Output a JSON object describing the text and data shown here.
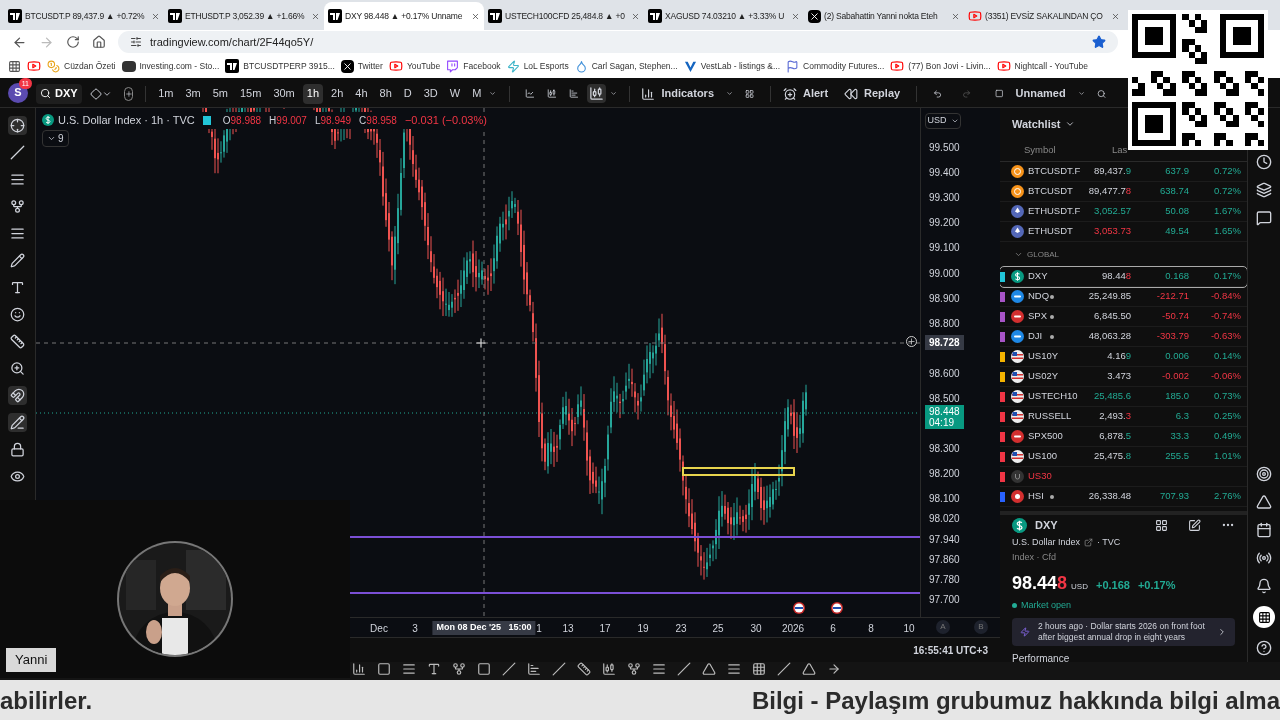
{
  "browser": {
    "tabs": [
      {
        "kind": "tv",
        "title": "BTCUSDT.P 89,437.9 ▲ +0.72%",
        "selected": false
      },
      {
        "kind": "tv",
        "title": "ETHUSDT.P 3,052.39 ▲ +1.66%",
        "selected": false
      },
      {
        "kind": "tv",
        "title": "DXY 98.448 ▲ +0.17% Unname",
        "selected": true
      },
      {
        "kind": "tv",
        "title": "USTECH100CFD 25,484.8 ▲ +0",
        "selected": false
      },
      {
        "kind": "tv",
        "title": "XAGUSD 74.03210 ▲ +3.33% U",
        "selected": false
      },
      {
        "kind": "x",
        "title": "(2) Sabahattin Yanni nokta Eteh",
        "selected": false
      },
      {
        "kind": "youtube",
        "title": "(3351) EVSİZ SAKALINDAN ÇO",
        "selected": false
      }
    ],
    "url": "tradingview.com/chart/2F44qo5Y/",
    "bookmarks": [
      {
        "kind": "youtube"
      },
      {
        "kind": "coin",
        "label": "Cüzdan Özeti"
      },
      {
        "kind": "inv",
        "label": "Investing.com - Sto..."
      },
      {
        "kind": "tv",
        "label": "BTCUSDTPERP 3915..."
      },
      {
        "kind": "x",
        "label": "Twitter"
      },
      {
        "kind": "youtube",
        "label": "YouTube"
      },
      {
        "kind": "twitch",
        "label": "Facebook"
      },
      {
        "kind": "lol",
        "label": "LoL Esports"
      },
      {
        "kind": "drop",
        "label": "Carl Sagan, Stephen..."
      },
      {
        "kind": "v",
        "label": "VestLab - listings &..."
      },
      {
        "kind": "flag",
        "label": "Commodity Futures..."
      },
      {
        "kind": "youtube",
        "label": "(77) Bon Jovi - Livin..."
      },
      {
        "kind": "youtube",
        "label": "Nightcall - YouTube"
      }
    ]
  },
  "toolbar": {
    "avatar": "S",
    "notifications": "11",
    "symbol": "DXY",
    "intervals": [
      {
        "label": "1m",
        "selected": false
      },
      {
        "label": "3m",
        "selected": false
      },
      {
        "label": "5m",
        "selected": false
      },
      {
        "label": "15m",
        "selected": false
      },
      {
        "label": "30m",
        "selected": false
      },
      {
        "label": "1h",
        "selected": true
      },
      {
        "label": "2h",
        "selected": false
      },
      {
        "label": "4h",
        "selected": false
      },
      {
        "label": "8h",
        "selected": false
      },
      {
        "label": "D",
        "selected": false
      },
      {
        "label": "3D",
        "selected": false
      },
      {
        "label": "W",
        "selected": false
      },
      {
        "label": "M",
        "selected": false
      }
    ],
    "indicators": "Indicators",
    "alert": "Alert",
    "replay": "Replay",
    "layout": "Unnamed"
  },
  "chart": {
    "title": "U.S. Dollar Index · 1h · TVC",
    "indicator_count": "9",
    "ohlc": [
      {
        "label": "O",
        "value": "98.988"
      },
      {
        "label": "H",
        "value": "99.007"
      },
      {
        "label": "L",
        "value": "98.949"
      },
      {
        "label": "C",
        "value": "98.958"
      }
    ],
    "change": "−0.031 (−0.03%)",
    "currency": "USD",
    "price_labels": [
      "99.500",
      "99.400",
      "99.300",
      "99.200",
      "99.100",
      "99.000",
      "98.900",
      "98.800",
      "98.600",
      "98.500",
      "98.300",
      "98.200",
      "98.100",
      "98.020",
      "97.940",
      "97.860",
      "97.780",
      "97.700"
    ],
    "crosshair_price": "98.728",
    "last_price": "98.448",
    "countdown": "04:19",
    "time_labels": [
      {
        "kind": "tick",
        "text": "Dec"
      },
      {
        "kind": "tick",
        "text": "3"
      },
      {
        "kind": "cursor",
        "text": "Mon 08 Dec '25   15:00"
      },
      {
        "kind": "tick",
        "text": "1"
      },
      {
        "kind": "tick",
        "text": "13"
      },
      {
        "kind": "tick",
        "text": "17"
      },
      {
        "kind": "tick",
        "text": "19"
      },
      {
        "kind": "tick",
        "text": "23"
      },
      {
        "kind": "tick",
        "text": "25"
      },
      {
        "kind": "tick",
        "text": "30"
      },
      {
        "kind": "tick",
        "text": "2026"
      },
      {
        "kind": "tick",
        "text": "6"
      },
      {
        "kind": "tick",
        "text": "8"
      },
      {
        "kind": "tick",
        "text": "10"
      },
      {
        "kind": "button",
        "text": "A"
      },
      {
        "kind": "button",
        "text": "B"
      }
    ],
    "clock": "16:55:41 UTC+3"
  },
  "watchlist": {
    "title": "Watchlist",
    "columns": [
      "Symbol",
      "Las"
    ],
    "rows": [
      {
        "kind": "crypto",
        "symbol": "BTCUSDT.F",
        "last": [
          {
            "text": "89,437."
          },
          {
            "text": "9",
            "up": true
          }
        ],
        "change": "637.9",
        "change_pct": "0.72%",
        "positive": true,
        "selected": false,
        "status_dot": false,
        "halted": false
      },
      {
        "kind": "crypto",
        "symbol": "BTCUSDT",
        "last": [
          {
            "text": "89,477.7"
          },
          {
            "text": "8",
            "up": false
          }
        ],
        "change": "638.74",
        "change_pct": "0.72%",
        "positive": true,
        "selected": false,
        "status_dot": false,
        "halted": false
      },
      {
        "kind": "eth",
        "symbol": "ETHUSDT.F",
        "last": [
          {
            "text": "3,052.57",
            "up": true
          }
        ],
        "change": "50.08",
        "change_pct": "1.67%",
        "positive": true,
        "selected": false,
        "status_dot": false,
        "halted": false
      },
      {
        "kind": "eth",
        "symbol": "ETHUSDT",
        "last": [
          {
            "text": "3,053.73",
            "up": false
          }
        ],
        "change": "49.54",
        "change_pct": "1.65%",
        "positive": true,
        "selected": false,
        "status_dot": false,
        "halted": false
      },
      {
        "kind": "group",
        "label": "GLOBAL",
        "expanded": true
      },
      {
        "kind": "dollar",
        "color": "#22c5d8",
        "symbol": "DXY",
        "last": [
          {
            "text": "98.44"
          },
          {
            "text": "8",
            "up": false
          }
        ],
        "change": "0.168",
        "change_pct": "0.17%",
        "positive": true,
        "selected": true,
        "status_dot": false,
        "halted": false
      },
      {
        "kind": "nasdaq",
        "color": "#a855c7",
        "symbol": "NDQ",
        "last": [
          {
            "text": "25,249.85"
          }
        ],
        "change": "-212.71",
        "change_pct": "-0.84%",
        "positive": false,
        "selected": false,
        "status_dot": true,
        "halted": false
      },
      {
        "kind": "sp",
        "color": "#a855c7",
        "symbol": "SPX",
        "last": [
          {
            "text": "6,845.50"
          }
        ],
        "change": "-50.74",
        "change_pct": "-0.74%",
        "positive": false,
        "selected": false,
        "status_dot": true,
        "halted": false
      },
      {
        "kind": "dow",
        "color": "#a855c7",
        "symbol": "DJI",
        "last": [
          {
            "text": "48,063.28"
          }
        ],
        "change": "-303.79",
        "change_pct": "-0.63%",
        "positive": false,
        "selected": false,
        "status_dot": true,
        "halted": false
      },
      {
        "kind": "us",
        "color": "#f5b400",
        "symbol": "US10Y",
        "last": [
          {
            "text": "4.16"
          },
          {
            "text": "9",
            "up": true
          }
        ],
        "change": "0.006",
        "change_pct": "0.14%",
        "positive": true,
        "selected": false,
        "status_dot": false,
        "halted": false
      },
      {
        "kind": "us",
        "color": "#f5b400",
        "symbol": "US02Y",
        "last": [
          {
            "text": "3.473"
          }
        ],
        "change": "-0.002",
        "change_pct": "-0.06%",
        "positive": false,
        "selected": false,
        "status_dot": false,
        "halted": false
      },
      {
        "kind": "us",
        "color": "#f23645",
        "symbol": "USTECH10",
        "last": [
          {
            "text": "25,485.6",
            "up": true
          }
        ],
        "change": "185.0",
        "change_pct": "0.73%",
        "positive": true,
        "selected": false,
        "status_dot": false,
        "halted": false
      },
      {
        "kind": "us",
        "color": "#f23645",
        "symbol": "RUSSELL",
        "last": [
          {
            "text": "2,493."
          },
          {
            "text": "3",
            "up": false
          }
        ],
        "change": "6.3",
        "change_pct": "0.25%",
        "positive": true,
        "selected": false,
        "status_dot": false,
        "halted": false
      },
      {
        "kind": "sp",
        "color": "#f23645",
        "symbol": "SPX500",
        "last": [
          {
            "text": "6,878."
          },
          {
            "text": "5",
            "up": true
          }
        ],
        "change": "33.3",
        "change_pct": "0.49%",
        "positive": true,
        "selected": false,
        "status_dot": false,
        "halted": false
      },
      {
        "kind": "us",
        "color": "#f23645",
        "symbol": "US100",
        "last": [
          {
            "text": "25,475."
          },
          {
            "text": "8",
            "up": true
          }
        ],
        "change": "255.5",
        "change_pct": "1.01%",
        "positive": true,
        "selected": false,
        "status_dot": false,
        "halted": false
      },
      {
        "kind": "letter",
        "color": "#f23645",
        "symbol": "US30",
        "selected": false,
        "status_dot": false,
        "halted": true
      },
      {
        "kind": "hk",
        "color": "#2962ff",
        "symbol": "HSI",
        "last": [
          {
            "text": "26,338.48"
          }
        ],
        "change": "707.93",
        "change_pct": "2.76%",
        "positive": true,
        "selected": false,
        "status_dot": true,
        "halted": false
      }
    ]
  },
  "details": {
    "symbol": "DXY",
    "name": "U.S. Dollar Index",
    "exchange": "· TVC",
    "type": "Index · Cfd",
    "price": [
      {
        "text": "98.44"
      },
      {
        "text": "8",
        "up": false
      }
    ],
    "currency": "USD",
    "change": "+0.168",
    "change_pct": "+0.17%",
    "positive": true,
    "market": "Market open",
    "market_open": true,
    "news": "2 hours ago · Dollar starts 2026 on front foot after biggest annual drop in eight years",
    "section": "Performance"
  },
  "webcam": {
    "kind": "picture",
    "name": "Yanni"
  },
  "caption": {
    "left": "abilirler.",
    "right": "Bilgi - Paylaşım grubumuz hakkında bilgi alma"
  }
}
